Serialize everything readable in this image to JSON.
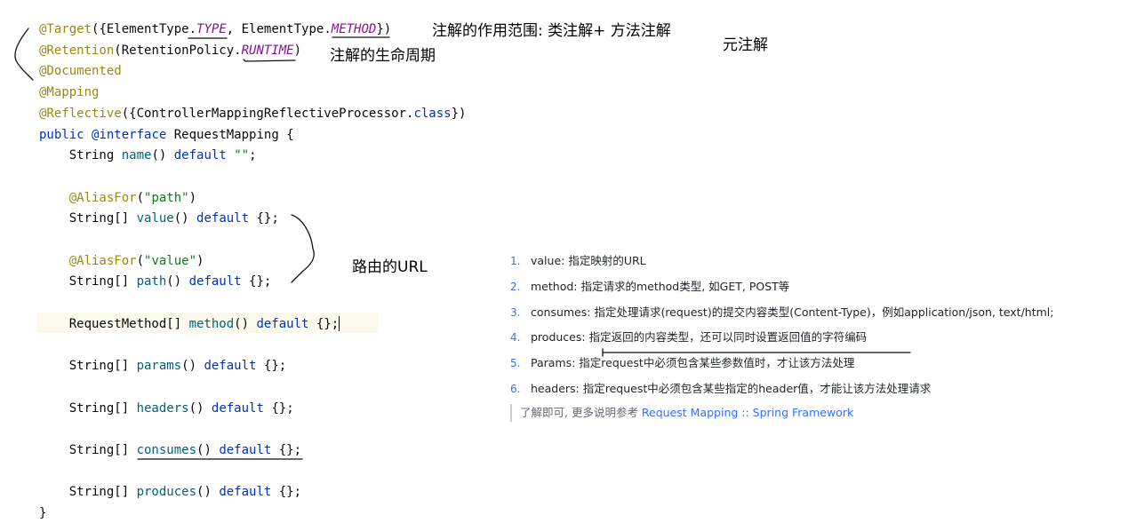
{
  "code": {
    "line1": {
      "p1": "@Target",
      "p2": "({ElementType.",
      "p3": "TYPE",
      "p4": ", ElementType.",
      "p5": "METHOD",
      "p6": "})"
    },
    "line2": {
      "p1": "@Retention",
      "p2": "(RetentionPolicy.",
      "p3": "RUNTIME",
      "p4": ")"
    },
    "line3": "@Documented",
    "line4": "@Mapping",
    "line5": {
      "p1": "@Reflective",
      "p2": "({ControllerMappingReflectiveProcessor.",
      "p3": "class",
      "p4": "})"
    },
    "line6": {
      "p1": "public",
      "p2": " ",
      "p3": "@interface",
      "p4": " RequestMapping {"
    },
    "line7": {
      "indent": "    ",
      "p1": "String ",
      "p2": "name",
      "p3": "() ",
      "p4": "default",
      "p5": " ",
      "p6": "\"\"",
      "p7": ";"
    },
    "line9": {
      "indent": "    ",
      "p1": "@AliasFor",
      "p2": "(",
      "p3": "\"path\"",
      "p4": ")"
    },
    "line10": {
      "indent": "    ",
      "p1": "String[] ",
      "p2": "value",
      "p3": "() ",
      "p4": "default",
      "p5": " {};"
    },
    "line12": {
      "indent": "    ",
      "p1": "@AliasFor",
      "p2": "(",
      "p3": "\"value\"",
      "p4": ")"
    },
    "line13": {
      "indent": "    ",
      "p1": "String[] ",
      "p2": "path",
      "p3": "() ",
      "p4": "default",
      "p5": " {};"
    },
    "line15": {
      "indent": "    ",
      "p1": "RequestMethod[] ",
      "p2": "method",
      "p3": "() ",
      "p4": "default",
      "p5": " {};"
    },
    "line17": {
      "indent": "    ",
      "p1": "String[] ",
      "p2": "params",
      "p3": "() ",
      "p4": "default",
      "p5": " {};"
    },
    "line19": {
      "indent": "    ",
      "p1": "String[] ",
      "p2": "headers",
      "p3": "() ",
      "p4": "default",
      "p5": " {};"
    },
    "line21": {
      "indent": "    ",
      "p1": "String[] ",
      "p2": "consumes",
      "p3": "() ",
      "p4": "default",
      "p5": " {};"
    },
    "line23": {
      "indent": "    ",
      "p1": "String[] ",
      "p2": "produces",
      "p3": "() ",
      "p4": "default",
      "p5": " {};"
    },
    "line24": "}"
  },
  "notes": {
    "scope": "注解的作用范围: 类注解+ 方法注解",
    "lifecycle": "注解的生命周期",
    "meta": "元注解",
    "url": "路由的URL"
  },
  "doc": {
    "items": [
      {
        "num": "1.",
        "text": "value: 指定映射的URL"
      },
      {
        "num": "2.",
        "text": "method: 指定请求的method类型, 如GET, POST等"
      },
      {
        "num": "3.",
        "text": "consumes: 指定处理请求(request)的提交内容类型(Content-Type)，例如application/json, text/html;"
      },
      {
        "num": "4.",
        "text": "produces: 指定返回的内容类型，还可以同时设置返回值的字符编码"
      },
      {
        "num": "5.",
        "text": "Params: 指定request中必须包含某些参数值时，才让该方法处理"
      },
      {
        "num": "6.",
        "text": "headers: 指定request中必须包含某些指定的header值，才能让该方法处理请求"
      }
    ],
    "quote_text": "了解即可, 更多说明参考 ",
    "quote_link": "Request Mapping :: Spring Framework"
  },
  "colors": {
    "annotation": "#9e880d",
    "keyword": "#0033b3",
    "string": "#067d17",
    "method": "#00627a",
    "enum_constant": "#871094",
    "link": "#3370ff",
    "current_line": "#fcfaed"
  }
}
